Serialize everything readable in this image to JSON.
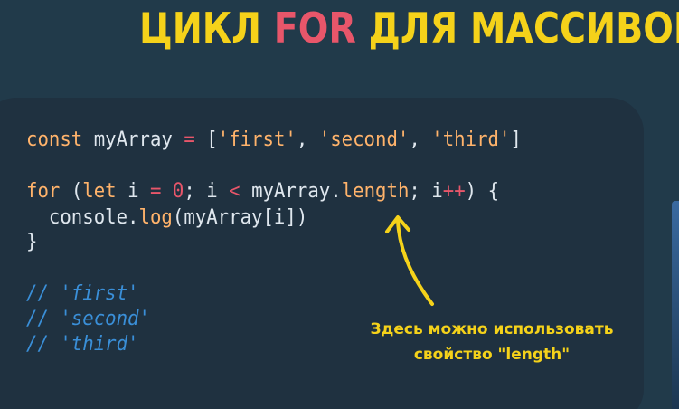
{
  "title": {
    "before": "ЦИКЛ ",
    "highlight": "FOR",
    "after": " ДЛЯ МАССИВОВ"
  },
  "code": {
    "line1": {
      "kw": "const",
      "name": " myArray ",
      "eq": "=",
      "open": " [",
      "s1": "'first'",
      "c1": ", ",
      "s2": "'second'",
      "c2": ", ",
      "s3": "'third'",
      "close": "]"
    },
    "line2": {
      "kw_for": "for",
      "p1": " (",
      "kw_let": "let",
      "p2": " i ",
      "eq": "=",
      "p3": " ",
      "zero": "0",
      "p4": "; i ",
      "lt": "<",
      "p5": " myArray.",
      "length": "length",
      "p6": "; i",
      "inc": "++",
      "p7": ") {"
    },
    "line3": {
      "indent": "  console.",
      "log": "log",
      "rest": "(myArray[i])"
    },
    "line4": "}"
  },
  "comments": [
    "// 'first'",
    "// 'second'",
    "// 'third'"
  ],
  "note": {
    "line1": "Здесь можно использовать",
    "line2": "свойство \"length\""
  },
  "colors": {
    "background": "#213a4a",
    "card": "#1f3140",
    "title": "#f5d21a",
    "title_highlight": "#e8566a",
    "keyword": "#ffb36b",
    "operator": "#e8566a",
    "comment": "#3a8fd8",
    "note": "#f5d21a"
  },
  "icons": {
    "arrow": "curved-up-arrow-icon"
  }
}
